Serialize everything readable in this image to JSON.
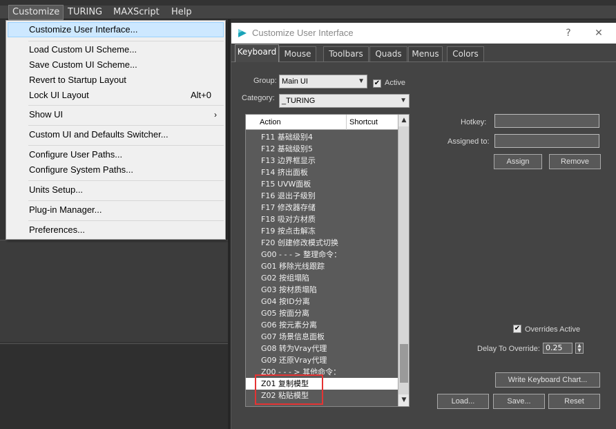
{
  "menubar": {
    "items": [
      "Customize",
      "TURING",
      "MAXScript",
      "Help"
    ]
  },
  "dropdown": {
    "items": [
      {
        "label": "Customize User Interface...",
        "shortcut": "",
        "submenu": false
      },
      {
        "label": "Load Custom UI Scheme...",
        "shortcut": "",
        "submenu": false
      },
      {
        "label": "Save Custom UI Scheme...",
        "shortcut": "",
        "submenu": false
      },
      {
        "label": "Revert to Startup Layout",
        "shortcut": "",
        "submenu": false
      },
      {
        "label": "Lock UI Layout",
        "shortcut": "Alt+0",
        "submenu": false
      },
      {
        "label": "Show UI",
        "shortcut": "",
        "submenu": true
      },
      {
        "label": "Custom UI and Defaults Switcher...",
        "shortcut": "",
        "submenu": false
      },
      {
        "label": "Configure User Paths...",
        "shortcut": "",
        "submenu": false
      },
      {
        "label": "Configure System Paths...",
        "shortcut": "",
        "submenu": false
      },
      {
        "label": "Units Setup...",
        "shortcut": "",
        "submenu": false
      },
      {
        "label": "Plug-in Manager...",
        "shortcut": "",
        "submenu": false
      },
      {
        "label": "Preferences...",
        "shortcut": "",
        "submenu": false
      }
    ],
    "submenu_glyph": "›"
  },
  "dialog": {
    "title": "Customize User Interface",
    "help_glyph": "?",
    "close_glyph": "✕",
    "tabs": [
      "Keyboard",
      "Mouse",
      "Toolbars",
      "Quads",
      "Menus",
      "Colors"
    ],
    "group_label": "Group:",
    "group_value": "Main UI",
    "active_label": "Active",
    "category_label": "Category:",
    "category_value": "_TURING",
    "list": {
      "col_action": "Action",
      "col_shortcut": "Shortcut",
      "rows": [
        "F11 基础级别4",
        "F12 基础级别5",
        "F13 边界框显示",
        "F14 挤出面板",
        "F15 UVW面板",
        "F16 退出子级别",
        "F17 修改器存储",
        "F18 吸对方材质",
        "F19 按点击解冻",
        "F20 创建修改模式切换",
        "G00 - - - > 整理命令：",
        "G01 移除光线跟踪",
        "G02 按组塌陷",
        "G03 按材质塌陷",
        "G04 按ID分离",
        "G05 按面分离",
        "G06 按元素分离",
        "G07 场景信息面板",
        "G08 转为Vray代理",
        "G09 还原Vray代理",
        "Z00 - - - > 其他命令：",
        "Z01 复制模型",
        "Z02 粘贴模型"
      ]
    },
    "hotkey_label": "Hotkey:",
    "hotkey_value": "",
    "assigned_label": "Assigned to:",
    "assigned_value": "",
    "assign_button": "Assign",
    "remove_button": "Remove",
    "overrides_label": "Overrides Active",
    "delay_label": "Delay To Override:",
    "delay_value": "0.25",
    "write_chart_button": "Write Keyboard Chart...",
    "load_button": "Load...",
    "save_button": "Save...",
    "reset_button": "Reset",
    "check_glyph": "✔"
  },
  "colors": {
    "menu_highlight": "#cde8ff",
    "dialog_bg": "#444444",
    "annotation_red": "#e53333",
    "logo_teal": "#1aa3b8"
  }
}
